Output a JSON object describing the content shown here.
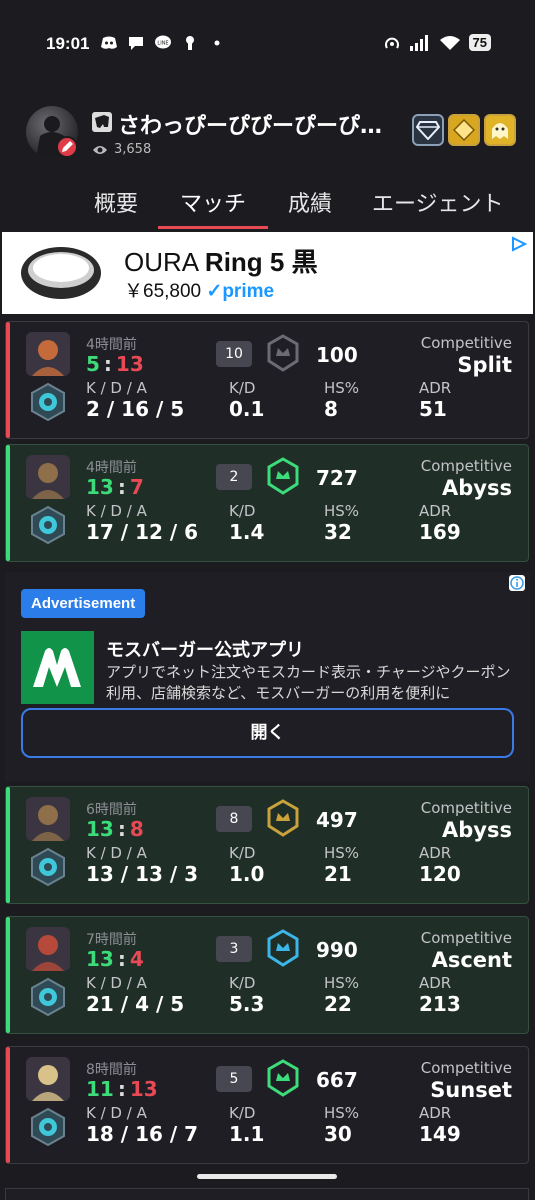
{
  "status_bar": {
    "time": "19:01",
    "battery": "75",
    "icons": [
      "discord-icon",
      "chat-icon",
      "line-icon",
      "keyhole-icon",
      "dot-icon"
    ]
  },
  "profile": {
    "username": "さわっぴーぴぴーぴーぴ…",
    "views": "3,658"
  },
  "tabs": [
    "概要",
    "マッチ",
    "成績",
    "エージェント"
  ],
  "active_tab": "マッチ",
  "top_ad": {
    "title_prefix": "OURA ",
    "title_bold": "Ring 5 ",
    "title_suffix": "黒",
    "price": "￥65,800",
    "prime": "prime"
  },
  "stat_labels": {
    "kda": "K / D / A",
    "kd": "K/D",
    "hs": "HS%",
    "adr": "ADR"
  },
  "matches": [
    {
      "result": "loss",
      "time_ago": "4時間前",
      "score_left": "5",
      "score_right": "13",
      "placement": "10",
      "rr": "100",
      "mode": "Competitive",
      "map": "Split",
      "kda": "2 / 16 / 5",
      "kd": "0.1",
      "hs": "8",
      "adr": "51",
      "agent_color": "#c56b3b",
      "rr_color": "#6b6b74"
    },
    {
      "result": "win",
      "time_ago": "4時間前",
      "score_left": "13",
      "score_right": "7",
      "placement": "2",
      "rr": "727",
      "mode": "Competitive",
      "map": "Abyss",
      "kda": "17 / 12 / 6",
      "kd": "1.4",
      "hs": "32",
      "adr": "169",
      "agent_color": "#8f6f4a",
      "rr_color": "#3ddc7a"
    },
    {
      "result": "win",
      "time_ago": "6時間前",
      "score_left": "13",
      "score_right": "8",
      "placement": "8",
      "rr": "497",
      "mode": "Competitive",
      "map": "Abyss",
      "kda": "13 / 13 / 3",
      "kd": "1.0",
      "hs": "21",
      "adr": "120",
      "agent_color": "#8f6f4a",
      "rr_color": "#c9a23b"
    },
    {
      "result": "win",
      "time_ago": "7時間前",
      "score_left": "13",
      "score_right": "4",
      "placement": "3",
      "rr": "990",
      "mode": "Competitive",
      "map": "Ascent",
      "kda": "21 / 4 / 5",
      "kd": "5.3",
      "hs": "22",
      "adr": "213",
      "agent_color": "#b54a3a",
      "rr_color": "#3cb6e8"
    },
    {
      "result": "loss",
      "time_ago": "8時間前",
      "score_left": "11",
      "score_right": "13",
      "placement": "5",
      "rr": "667",
      "mode": "Competitive",
      "map": "Sunset",
      "kda": "18 / 16 / 7",
      "kd": "1.1",
      "hs": "30",
      "adr": "149",
      "agent_color": "#d8c28a",
      "rr_color": "#3ddc7a"
    }
  ],
  "mid_ad": {
    "badge": "Advertisement",
    "name": "モスバーガー公式アプリ",
    "description": "アプリでネット注文やモスカード表示・チャージやクーポン利用、店舗検索など、モスバーガーの利用を便利に",
    "button": "開く"
  },
  "colors": {
    "win": "#3ddc7a",
    "loss": "#e84a55",
    "accent": "#e84a55",
    "ad_blue": "#2b7de9"
  }
}
